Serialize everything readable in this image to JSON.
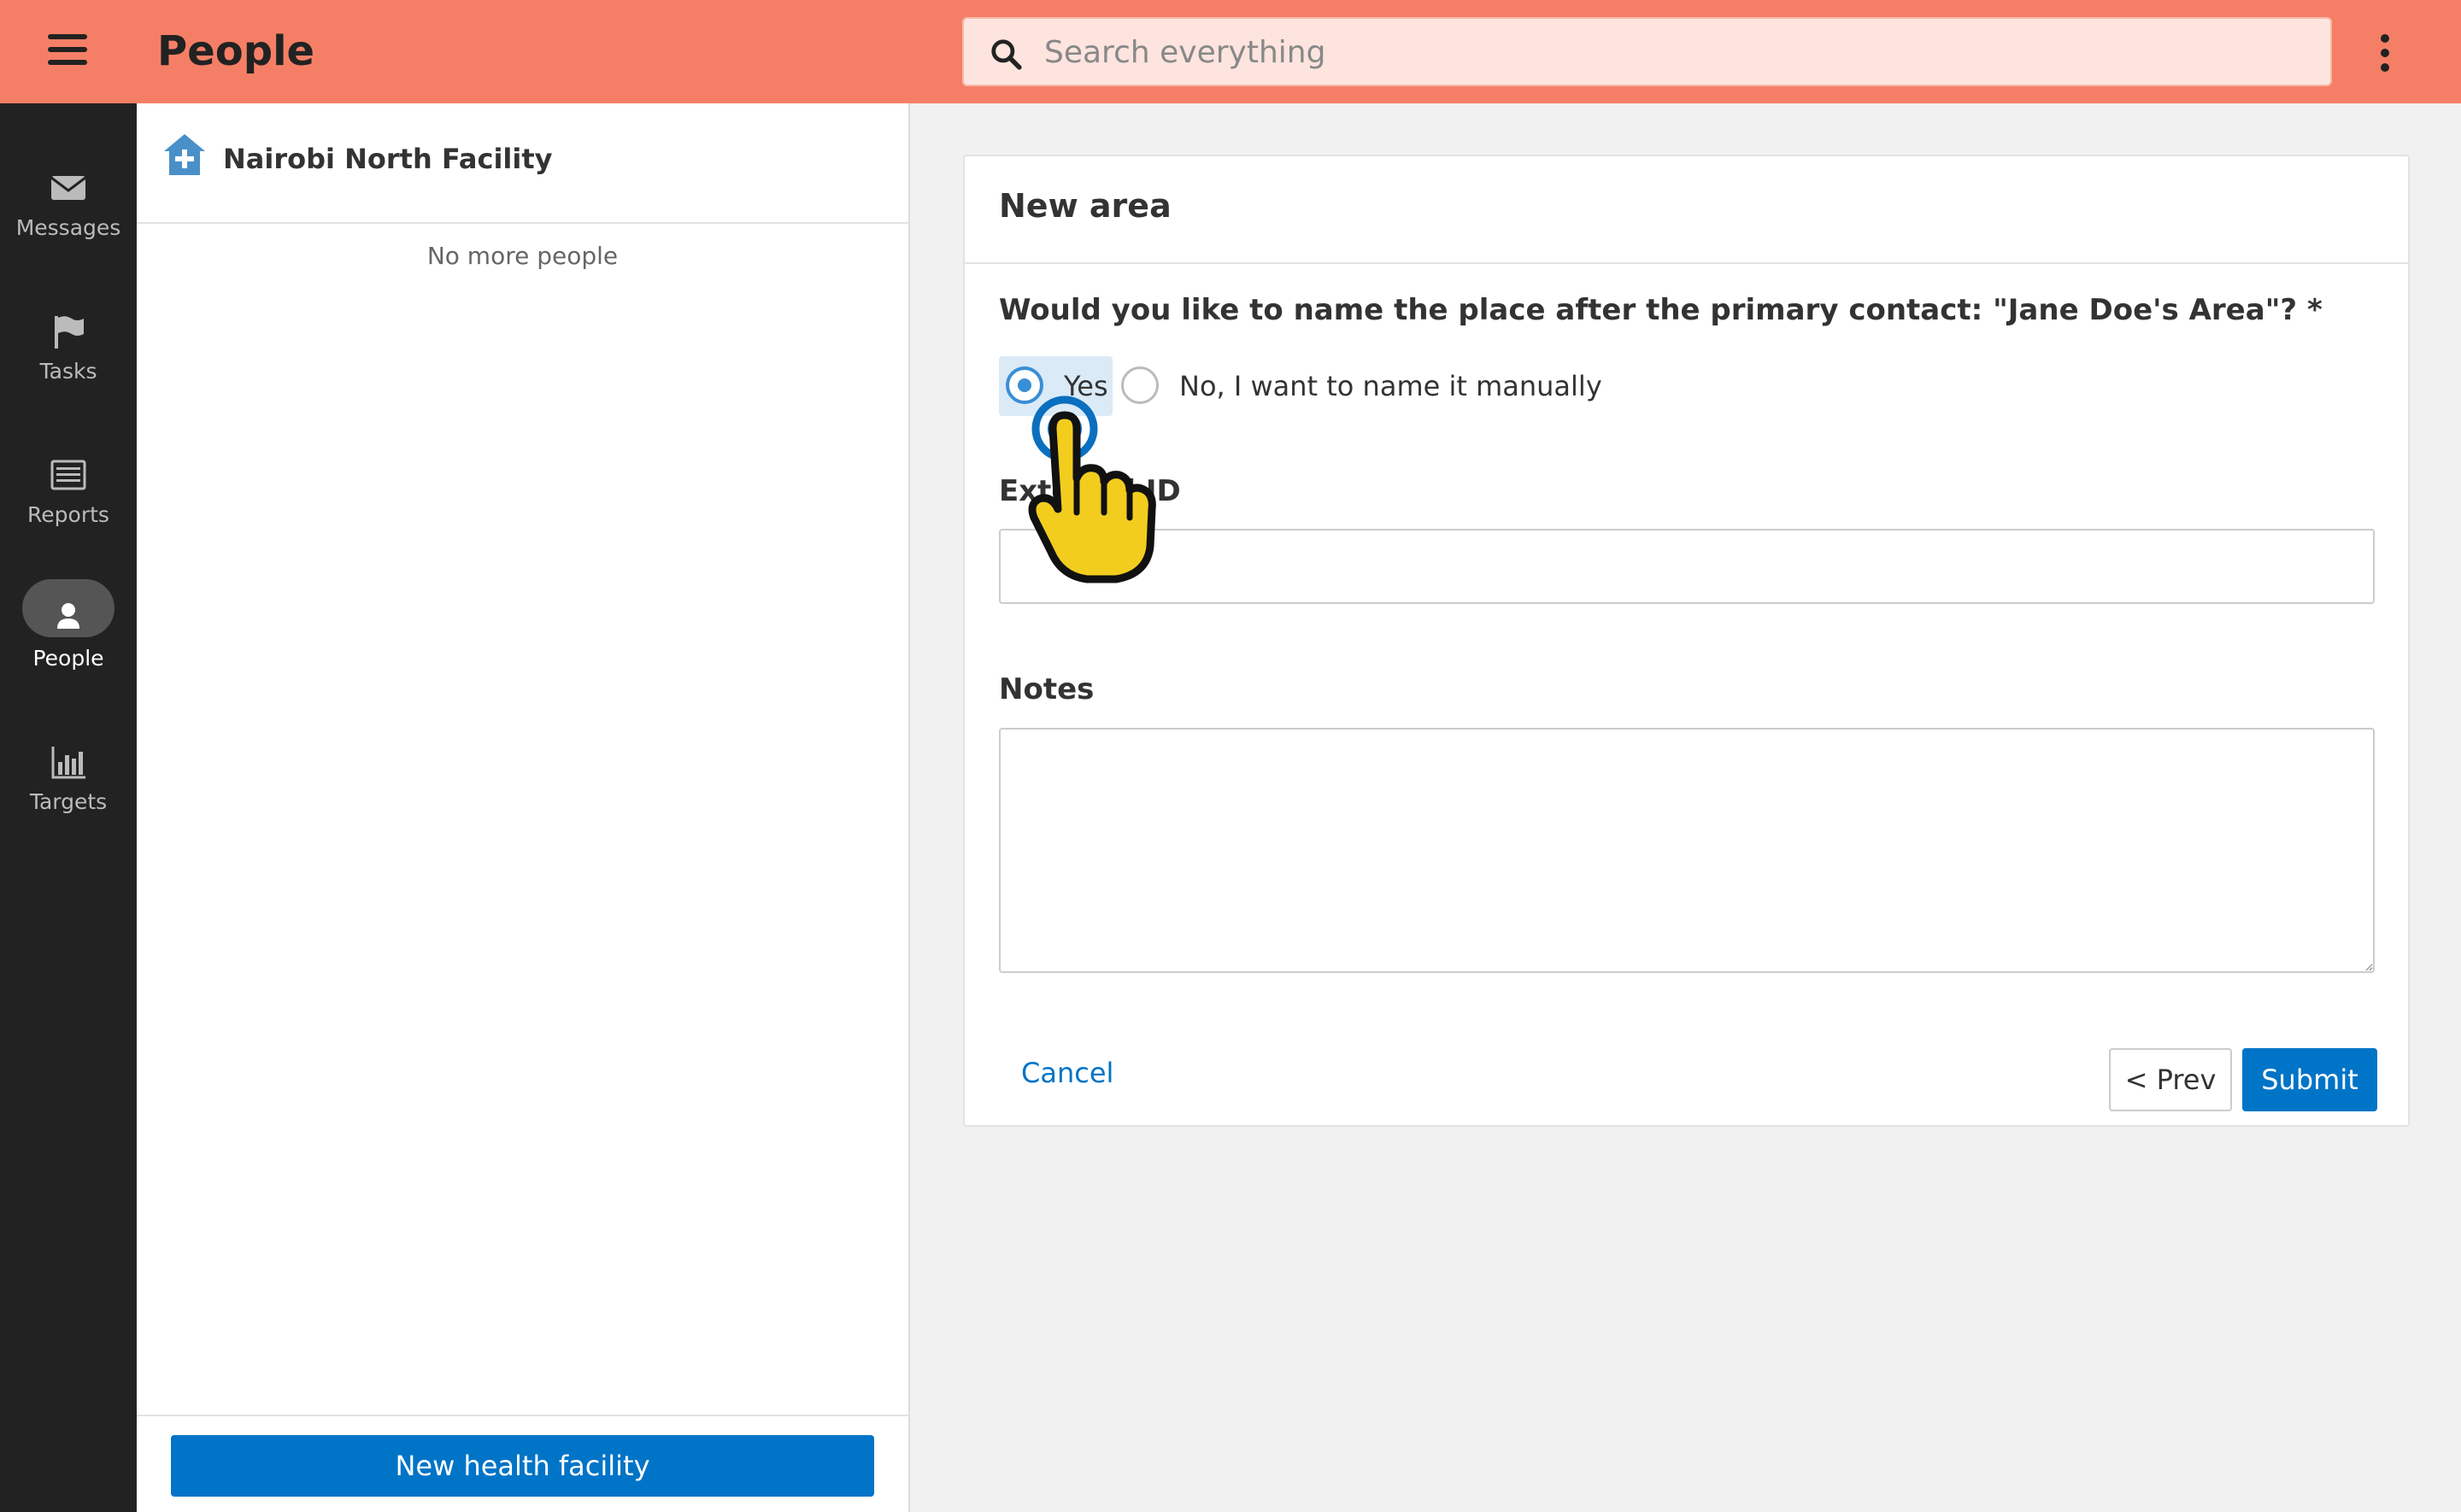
{
  "header": {
    "title": "People",
    "search_placeholder": "Search everything",
    "menu_icon": "hamburger-menu-icon",
    "overflow_icon": "kebab-menu-icon",
    "background_color": "#f57f66"
  },
  "nav": {
    "items": [
      {
        "label": "Messages",
        "icon": "envelope-icon",
        "active": false
      },
      {
        "label": "Tasks",
        "icon": "flag-icon",
        "active": false
      },
      {
        "label": "Reports",
        "icon": "list-icon",
        "active": false
      },
      {
        "label": "People",
        "icon": "person-icon",
        "active": true
      },
      {
        "label": "Targets",
        "icon": "bar-chart-icon",
        "active": false
      }
    ]
  },
  "contacts": {
    "facility_name": "Nairobi North Facility",
    "facility_icon": "health-facility-icon",
    "empty_text": "No more people",
    "new_button_label": "New health facility"
  },
  "form": {
    "title": "New area",
    "question": "Would you like to name the place after the primary contact: \"Jane Doe's Area\"? *",
    "options": [
      {
        "label": "Yes",
        "selected": true
      },
      {
        "label": "No, I want to name it manually",
        "selected": false
      }
    ],
    "external_id_label": "External ID",
    "external_id_value": "",
    "notes_label": "Notes",
    "notes_value": "",
    "cancel_label": "Cancel",
    "prev_label": "< Prev",
    "submit_label": "Submit",
    "accent_color": "#0074c7"
  }
}
